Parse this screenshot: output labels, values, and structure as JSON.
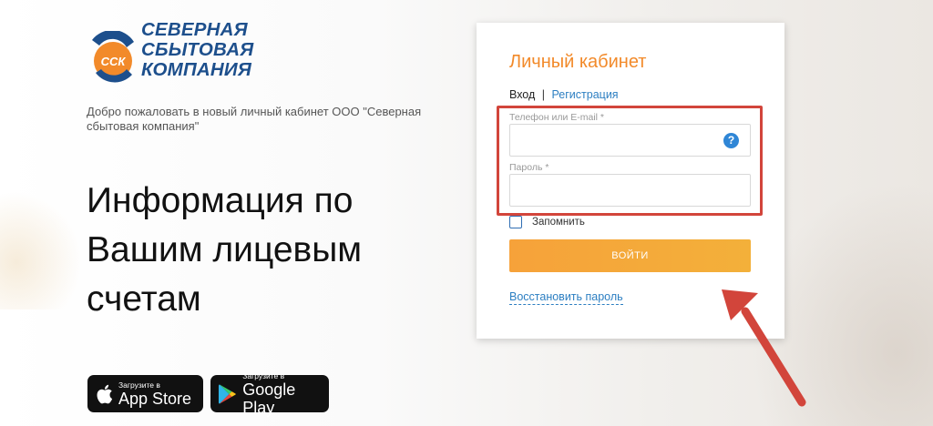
{
  "logo": {
    "mark_text": "ССК",
    "lines": [
      "СЕВЕРНАЯ",
      "СБЫТОВАЯ",
      "КОМПАНИЯ"
    ],
    "colors": {
      "primary": "#1d4f8c",
      "accent": "#f28a2a"
    }
  },
  "welcome_text": "Добро пожаловать в новый личный кабинет ООО \"Северная сбытовая компания\"",
  "headline": "Информация по Вашим лицевым счетам",
  "stores": {
    "appstore": {
      "sub": "Загрузите в",
      "main": "App Store",
      "icon": "apple-icon"
    },
    "googleplay": {
      "sub": "Загрузите в",
      "main": "Google Play",
      "icon": "google-play-icon"
    }
  },
  "login": {
    "title": "Личный кабинет",
    "tab_login": "Вход",
    "tab_separator": "|",
    "tab_register": "Регистрация",
    "phone_label": "Телефон или E-mail *",
    "phone_value": "",
    "help_icon": "?",
    "password_label": "Пароль *",
    "password_value": "",
    "remember_label": "Запомнить",
    "remember_checked": false,
    "submit_label": "ВОЙТИ",
    "restore_link": "Восстановить пароль"
  },
  "colors": {
    "title_orange": "#f28a2a",
    "link_blue": "#2d7fc2",
    "button_orange": "#f6a23a",
    "highlight_red": "#d2453b"
  }
}
